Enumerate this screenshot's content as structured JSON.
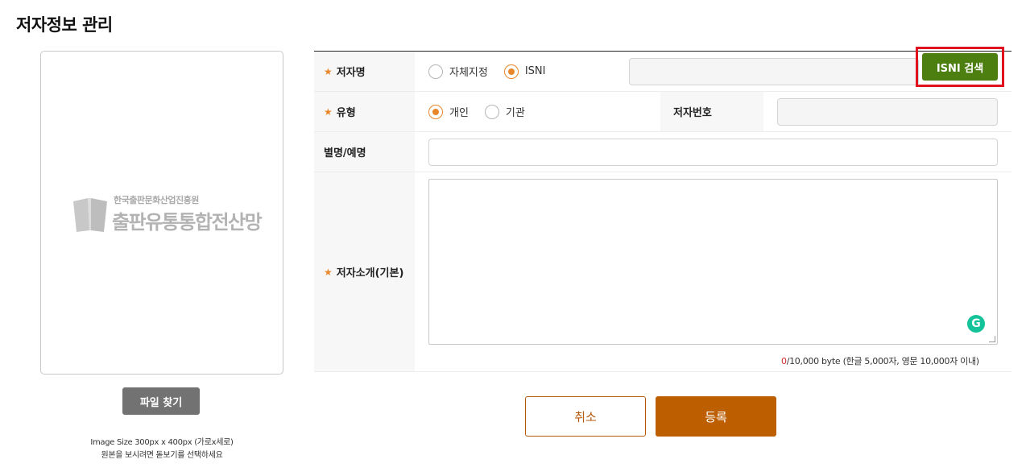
{
  "page": {
    "title": "저자정보 관리"
  },
  "image_panel": {
    "logo_org": "한국출판문화산업진흥원",
    "logo_name": "출판유통통합전산망",
    "file_button": "파일 찾기",
    "note_line1": "Image Size 300px x 400px (가로x세로)",
    "note_line2": "원본을 보시려면 돋보기를 선택하세요"
  },
  "form": {
    "required_mark": "★",
    "author_name": {
      "label": "저자명",
      "options": [
        "자체지정",
        "ISNI"
      ],
      "selected": "ISNI",
      "value": "",
      "search_button": "ISNI 검색"
    },
    "type": {
      "label": "유형",
      "options": [
        "개인",
        "기관"
      ],
      "selected": "개인",
      "author_number_label": "저자번호",
      "author_number_value": ""
    },
    "alias": {
      "label": "별명/예명",
      "value": ""
    },
    "intro": {
      "label": "저자소개(기본)",
      "value": "",
      "byte_current": "0",
      "byte_limit": "/10,000 byte (한글 5,000자, 영문 10,000자 이내)",
      "grammar_icon": "G"
    }
  },
  "actions": {
    "cancel": "취소",
    "submit": "등록"
  },
  "colors": {
    "accent": "#e8872a",
    "isni_button": "#4c7f10",
    "submit": "#bd5e00",
    "highlight": "#e0121f"
  }
}
